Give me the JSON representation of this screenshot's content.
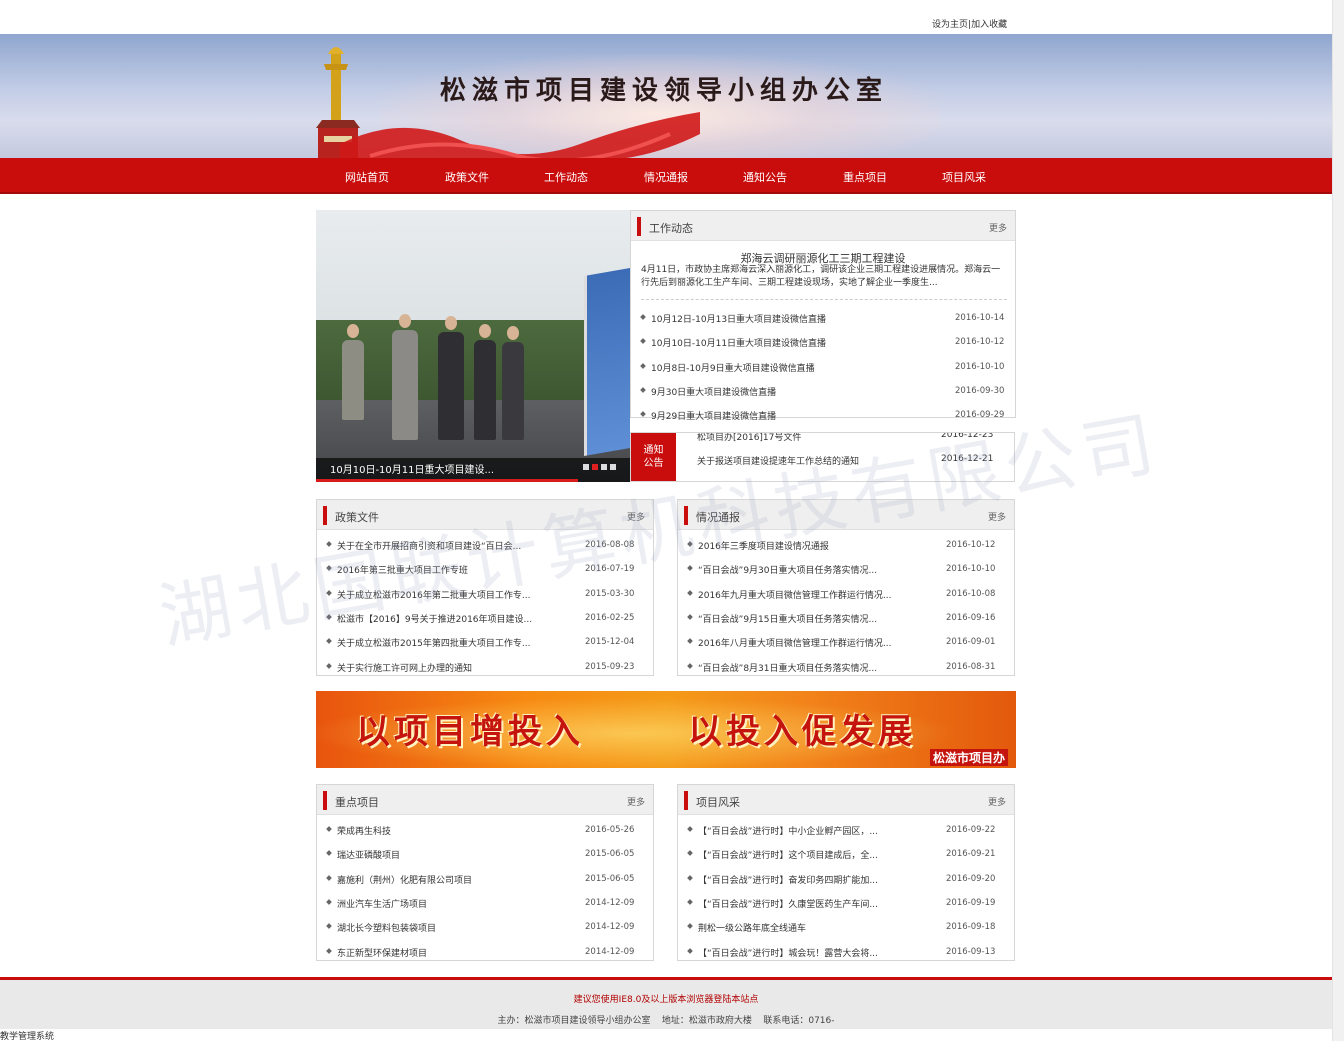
{
  "top_links": {
    "home": "设为主页",
    "sep": "|",
    "fav": "加入收藏"
  },
  "banner": {
    "title": "松滋市项目建设领导小组办公室"
  },
  "nav": [
    "网站首页",
    "政策文件",
    "工作动态",
    "情况通报",
    "通知公告",
    "重点项目",
    "项目风采"
  ],
  "slider": {
    "caption": "10月10日-10月11日重大项目建设...",
    "slide_count": 4,
    "active_index": 1
  },
  "work_news": {
    "title": "工作动态",
    "more": "更多",
    "featured_title": "郑海云调研丽源化工三期工程建设",
    "featured_text": "4月11日，市政协主席郑海云深入丽源化工，调研该企业三期工程建设进展情况。郑海云一行先后到丽源化工生产车间、三期工程建设现场，实地了解企业一季度生...",
    "items": [
      {
        "text": "10月12日-10月13日重大项目建设微信直播",
        "date": "2016-10-14"
      },
      {
        "text": "10月10日-10月11日重大项目建设微信直播",
        "date": "2016-10-12"
      },
      {
        "text": "10月8日-10月9日重大项目建设微信直播",
        "date": "2016-10-10"
      },
      {
        "text": "9月30日重大项目建设微信直播",
        "date": "2016-09-30"
      },
      {
        "text": "9月29日重大项目建设微信直播",
        "date": "2016-09-29"
      }
    ]
  },
  "notice": {
    "tag_line1": "通知",
    "tag_line2": "公告",
    "items": [
      {
        "text": "松项目办[2016]17号文件",
        "date": "2016-12-23"
      },
      {
        "text": "关于报送项目建设提速年工作总结的通知",
        "date": "2016-12-21"
      }
    ]
  },
  "policy": {
    "title": "政策文件",
    "more": "更多",
    "items": [
      {
        "text": "关于在全市开展招商引资和项目建设“百日会...",
        "date": "2016-08-08"
      },
      {
        "text": "2016年第三批重大项目工作专班",
        "date": "2016-07-19"
      },
      {
        "text": "关于成立松滋市2016年第二批重大项目工作专...",
        "date": "2015-03-30"
      },
      {
        "text": "松滋市【2016】9号关于推进2016年项目建设...",
        "date": "2016-02-25"
      },
      {
        "text": "关于成立松滋市2015年第四批重大项目工作专...",
        "date": "2015-12-04"
      },
      {
        "text": "关于实行施工许可网上办理的通知",
        "date": "2015-09-23"
      }
    ]
  },
  "report": {
    "title": "情况通报",
    "more": "更多",
    "items": [
      {
        "text": "2016年三季度项目建设情况通报",
        "date": "2016-10-12"
      },
      {
        "text": "“百日会战”9月30日重大项目任务落实情况...",
        "date": "2016-10-10"
      },
      {
        "text": "2016年九月重大项目微信管理工作群运行情况...",
        "date": "2016-10-08"
      },
      {
        "text": "“百日会战”9月15日重大项目任务落实情况...",
        "date": "2016-09-16"
      },
      {
        "text": "2016年八月重大项目微信管理工作群运行情况...",
        "date": "2016-09-01"
      },
      {
        "text": "“百日会战”8月31日重大项目任务落实情况...",
        "date": "2016-08-31"
      }
    ]
  },
  "promo": {
    "slogan_left": "以项目增投入",
    "slogan_right": "以投入促发展",
    "signature": "松滋市项目办"
  },
  "key_projects": {
    "title": "重点项目",
    "more": "更多",
    "items": [
      {
        "text": "荣成再生科技",
        "date": "2016-05-26"
      },
      {
        "text": "瑞达亚磷酸项目",
        "date": "2015-06-05"
      },
      {
        "text": "嘉施利（荆州）化肥有限公司项目",
        "date": "2015-06-05"
      },
      {
        "text": "洲业汽车生活广场项目",
        "date": "2014-12-09"
      },
      {
        "text": "湖北长今塑料包装袋项目",
        "date": "2014-12-09"
      },
      {
        "text": "东正新型环保建材项目",
        "date": "2014-12-09"
      }
    ]
  },
  "project_style": {
    "title": "项目风采",
    "more": "更多",
    "items": [
      {
        "text": "【“百日会战”进行时】中小企业孵产园区，...",
        "date": "2016-09-22"
      },
      {
        "text": "【“百日会战”进行时】这个项目建成后，全...",
        "date": "2016-09-21"
      },
      {
        "text": "【“百日会战”进行时】奋发印务四期扩能加...",
        "date": "2016-09-20"
      },
      {
        "text": "【“百日会战”进行时】久康堂医药生产车间...",
        "date": "2016-09-19"
      },
      {
        "text": "荆松一级公路年底全线通车",
        "date": "2016-09-18"
      },
      {
        "text": "【“百日会战”进行时】城会玩！露营大会将...",
        "date": "2016-09-13"
      }
    ]
  },
  "footer": {
    "tip": "建议您使用IE8.0及以上版本浏览器登陆本站点",
    "info": "主办：松滋市项目建设领导小组办公室    地址：松滋市政府大楼    联系电话：0716-"
  },
  "status_text": "教学管理系统",
  "watermark": "湖北国联计算机科技有限公司",
  "colors": {
    "accent": "#c90d0d",
    "nav_bg": "#c90d0d",
    "footer_bg": "#e9e9e9"
  }
}
